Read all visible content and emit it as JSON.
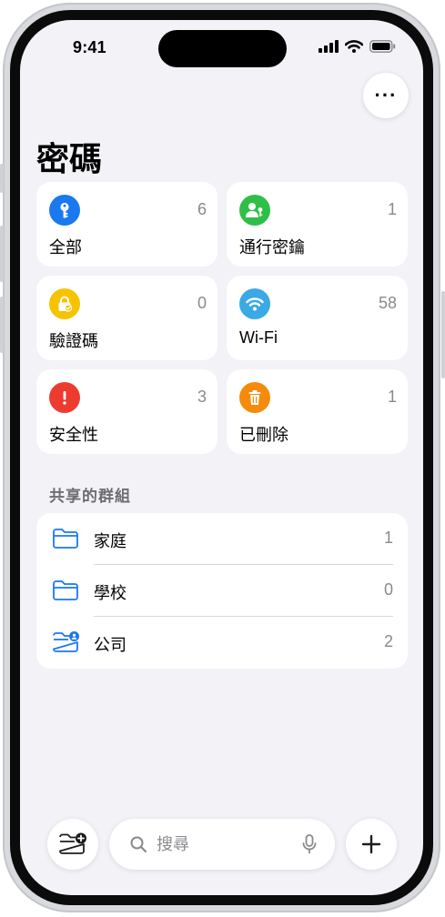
{
  "status_bar": {
    "time": "9:41"
  },
  "header": {
    "more_glyph": "···",
    "title": "密碼"
  },
  "categories": [
    {
      "label": "全部",
      "count": "6",
      "icon": "key-icon",
      "color": "#1a78f0"
    },
    {
      "label": "通行密鑰",
      "count": "1",
      "icon": "passkey-person-icon",
      "color": "#2fbf48"
    },
    {
      "label": "驗證碼",
      "count": "0",
      "icon": "lock-check-icon",
      "color": "#f7c300"
    },
    {
      "label": "Wi-Fi",
      "count": "58",
      "icon": "wifi-icon",
      "color": "#3aa9e6"
    },
    {
      "label": "安全性",
      "count": "3",
      "icon": "exclamation-icon",
      "color": "#ee3b30"
    },
    {
      "label": "已刪除",
      "count": "1",
      "icon": "trash-icon",
      "color": "#f58a0b"
    }
  ],
  "shared_groups": {
    "header": "共享的群組",
    "items": [
      {
        "label": "家庭",
        "count": "1",
        "icon": "folder-icon"
      },
      {
        "label": "學校",
        "count": "0",
        "icon": "folder-icon"
      },
      {
        "label": "公司",
        "count": "2",
        "icon": "folder-person-icon"
      }
    ]
  },
  "bottom_bar": {
    "search_placeholder": "搜尋"
  },
  "colors": {
    "accent": "#1a78f0",
    "background": "#f2f2f7",
    "secondary_text": "#8a8a8e"
  }
}
